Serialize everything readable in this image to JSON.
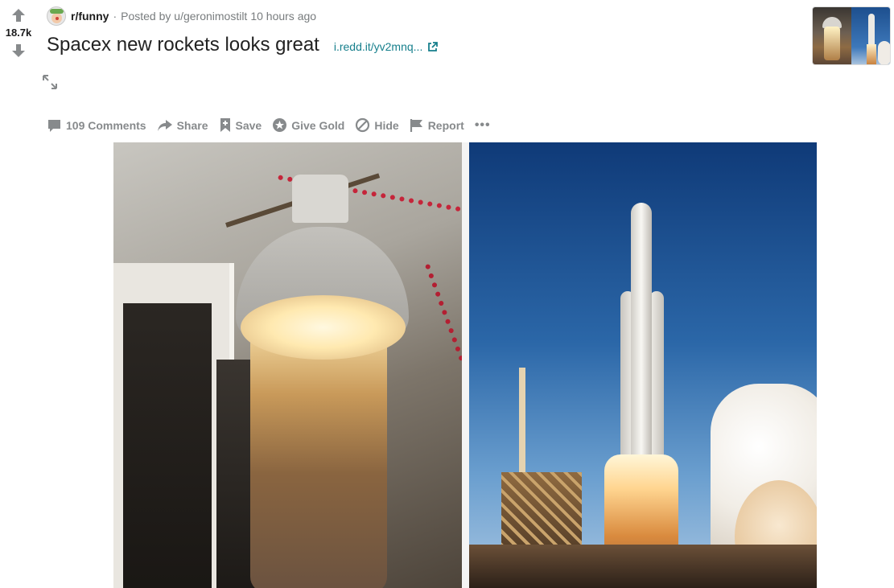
{
  "post": {
    "score": "18.7k",
    "subreddit": "r/funny",
    "separator": "·",
    "posted_by_prefix": "Posted by",
    "author": "u/geronimostilt",
    "time_ago": "10 hours ago",
    "title": "Spacex new rockets looks great",
    "domain": "i.redd.it/yv2mnq..."
  },
  "actions": {
    "comments": "109 Comments",
    "share": "Share",
    "save": "Save",
    "give_gold": "Give Gold",
    "hide": "Hide",
    "report": "Report",
    "more": "•••"
  },
  "icons": {
    "upvote": "upvote-arrow-icon",
    "downvote": "downvote-arrow-icon",
    "expand": "expand-icon",
    "external_link": "external-link-icon",
    "comment": "comment-bubble-icon",
    "share": "share-arrow-icon",
    "save": "bookmark-plus-icon",
    "gold": "gold-star-icon",
    "hide": "hide-slash-icon",
    "report": "flag-icon"
  },
  "colors": {
    "meta_text": "#787c7e",
    "action_text": "#878a8c",
    "link": "#167f8c",
    "title": "#222222"
  }
}
